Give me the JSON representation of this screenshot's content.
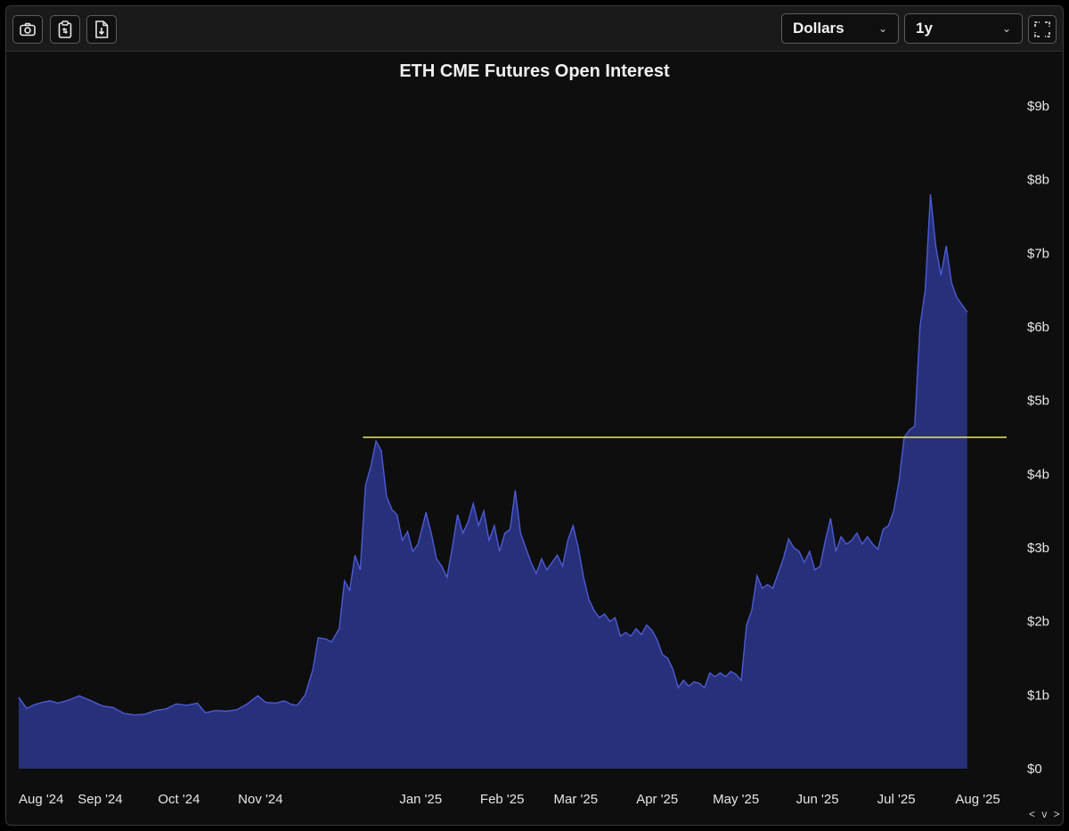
{
  "toolbar": {
    "buttons": [
      {
        "name": "camera-icon"
      },
      {
        "name": "clipboard-icon"
      },
      {
        "name": "download-file-icon"
      }
    ],
    "unit_select": {
      "value": "Dollars"
    },
    "range_select": {
      "value": "1y"
    },
    "fullscreen_icon": "fullscreen-icon"
  },
  "colors": {
    "background": "#0e0e0e",
    "area_fill": "#28307a",
    "area_stroke": "#4b5bd6",
    "reference_line": "#e8e85a"
  },
  "nav_hint": "< v >",
  "chart_data": {
    "type": "area",
    "title": "ETH CME Futures Open Interest",
    "xlabel": "",
    "ylabel": "",
    "ylim": [
      0,
      9
    ],
    "y_unit": "billions USD",
    "y_ticks": [
      "$0",
      "$1b",
      "$2b",
      "$3b",
      "$4b",
      "$5b",
      "$6b",
      "$7b",
      "$8b",
      "$9b"
    ],
    "y_tick_values": [
      0,
      1,
      2,
      3,
      4,
      5,
      6,
      7,
      8,
      9
    ],
    "x_ticks": [
      {
        "label": "Aug '24",
        "date": "2024-08-01"
      },
      {
        "label": "Sep '24",
        "date": "2024-09-01"
      },
      {
        "label": "Oct '24",
        "date": "2024-10-01"
      },
      {
        "label": "Nov '24",
        "date": "2024-11-01"
      },
      {
        "label": "Jan '25",
        "date": "2025-01-01"
      },
      {
        "label": "Feb '25",
        "date": "2025-02-01"
      },
      {
        "label": "Mar '25",
        "date": "2025-03-01"
      },
      {
        "label": "Apr '25",
        "date": "2025-04-01"
      },
      {
        "label": "May '25",
        "date": "2025-05-01"
      },
      {
        "label": "Jun '25",
        "date": "2025-06-01"
      },
      {
        "label": "Jul '25",
        "date": "2025-07-01"
      },
      {
        "label": "Aug '25",
        "date": "2025-08-01"
      }
    ],
    "x_range": [
      "2024-08-01",
      "2025-08-12"
    ],
    "reference_line": {
      "y": 4.5,
      "x_start": "2024-12-10",
      "x_end": "2025-08-12"
    },
    "series": [
      {
        "values": [
          [
            "2024-08-01",
            0.97
          ],
          [
            "2024-08-04",
            0.82
          ],
          [
            "2024-08-07",
            0.87
          ],
          [
            "2024-08-10",
            0.9
          ],
          [
            "2024-08-13",
            0.92
          ],
          [
            "2024-08-16",
            0.89
          ],
          [
            "2024-08-20",
            0.93
          ],
          [
            "2024-08-24",
            0.99
          ],
          [
            "2024-08-28",
            0.93
          ],
          [
            "2024-09-02",
            0.85
          ],
          [
            "2024-09-06",
            0.83
          ],
          [
            "2024-09-10",
            0.75
          ],
          [
            "2024-09-14",
            0.73
          ],
          [
            "2024-09-18",
            0.74
          ],
          [
            "2024-09-22",
            0.79
          ],
          [
            "2024-09-26",
            0.81
          ],
          [
            "2024-09-30",
            0.88
          ],
          [
            "2024-10-04",
            0.86
          ],
          [
            "2024-10-08",
            0.89
          ],
          [
            "2024-10-11",
            0.76
          ],
          [
            "2024-10-15",
            0.79
          ],
          [
            "2024-10-19",
            0.78
          ],
          [
            "2024-10-23",
            0.8
          ],
          [
            "2024-10-27",
            0.88
          ],
          [
            "2024-10-31",
            0.99
          ],
          [
            "2024-11-03",
            0.9
          ],
          [
            "2024-11-07",
            0.89
          ],
          [
            "2024-11-10",
            0.92
          ],
          [
            "2024-11-13",
            0.87
          ],
          [
            "2024-11-15",
            0.86
          ],
          [
            "2024-11-18",
            1.0
          ],
          [
            "2024-11-21",
            1.35
          ],
          [
            "2024-11-23",
            1.78
          ],
          [
            "2024-11-26",
            1.76
          ],
          [
            "2024-11-28",
            1.72
          ],
          [
            "2024-12-01",
            1.9
          ],
          [
            "2024-12-03",
            2.55
          ],
          [
            "2024-12-05",
            2.42
          ],
          [
            "2024-12-07",
            2.9
          ],
          [
            "2024-12-09",
            2.7
          ],
          [
            "2024-12-11",
            3.85
          ],
          [
            "2024-12-13",
            4.1
          ],
          [
            "2024-12-15",
            4.45
          ],
          [
            "2024-12-17",
            4.32
          ],
          [
            "2024-12-19",
            3.7
          ],
          [
            "2024-12-21",
            3.52
          ],
          [
            "2024-12-23",
            3.45
          ],
          [
            "2024-12-25",
            3.1
          ],
          [
            "2024-12-27",
            3.22
          ],
          [
            "2024-12-29",
            2.95
          ],
          [
            "2024-12-31",
            3.05
          ],
          [
            "2025-01-03",
            3.48
          ],
          [
            "2025-01-05",
            3.2
          ],
          [
            "2025-01-07",
            2.85
          ],
          [
            "2025-01-09",
            2.75
          ],
          [
            "2025-01-11",
            2.6
          ],
          [
            "2025-01-13",
            3.0
          ],
          [
            "2025-01-15",
            3.45
          ],
          [
            "2025-01-17",
            3.2
          ],
          [
            "2025-01-19",
            3.35
          ],
          [
            "2025-01-21",
            3.6
          ],
          [
            "2025-01-23",
            3.3
          ],
          [
            "2025-01-25",
            3.5
          ],
          [
            "2025-01-27",
            3.1
          ],
          [
            "2025-01-29",
            3.3
          ],
          [
            "2025-01-31",
            2.95
          ],
          [
            "2025-02-02",
            3.2
          ],
          [
            "2025-02-04",
            3.25
          ],
          [
            "2025-02-06",
            3.78
          ],
          [
            "2025-02-08",
            3.2
          ],
          [
            "2025-02-10",
            3.0
          ],
          [
            "2025-02-12",
            2.8
          ],
          [
            "2025-02-14",
            2.65
          ],
          [
            "2025-02-16",
            2.85
          ],
          [
            "2025-02-18",
            2.7
          ],
          [
            "2025-02-20",
            2.8
          ],
          [
            "2025-02-22",
            2.9
          ],
          [
            "2025-02-24",
            2.75
          ],
          [
            "2025-02-26",
            3.1
          ],
          [
            "2025-02-28",
            3.3
          ],
          [
            "2025-03-02",
            3.0
          ],
          [
            "2025-03-04",
            2.6
          ],
          [
            "2025-03-06",
            2.3
          ],
          [
            "2025-03-08",
            2.15
          ],
          [
            "2025-03-10",
            2.05
          ],
          [
            "2025-03-12",
            2.1
          ],
          [
            "2025-03-14",
            2.0
          ],
          [
            "2025-03-16",
            2.05
          ],
          [
            "2025-03-18",
            1.8
          ],
          [
            "2025-03-20",
            1.85
          ],
          [
            "2025-03-22",
            1.8
          ],
          [
            "2025-03-24",
            1.9
          ],
          [
            "2025-03-26",
            1.82
          ],
          [
            "2025-03-28",
            1.95
          ],
          [
            "2025-03-30",
            1.88
          ],
          [
            "2025-04-01",
            1.75
          ],
          [
            "2025-04-03",
            1.55
          ],
          [
            "2025-04-05",
            1.5
          ],
          [
            "2025-04-07",
            1.35
          ],
          [
            "2025-04-09",
            1.1
          ],
          [
            "2025-04-11",
            1.2
          ],
          [
            "2025-04-13",
            1.12
          ],
          [
            "2025-04-15",
            1.18
          ],
          [
            "2025-04-17",
            1.16
          ],
          [
            "2025-04-19",
            1.1
          ],
          [
            "2025-04-21",
            1.3
          ],
          [
            "2025-04-23",
            1.25
          ],
          [
            "2025-04-25",
            1.3
          ],
          [
            "2025-04-27",
            1.25
          ],
          [
            "2025-04-29",
            1.32
          ],
          [
            "2025-05-01",
            1.28
          ],
          [
            "2025-05-03",
            1.2
          ],
          [
            "2025-05-05",
            1.95
          ],
          [
            "2025-05-07",
            2.15
          ],
          [
            "2025-05-09",
            2.62
          ],
          [
            "2025-05-11",
            2.45
          ],
          [
            "2025-05-13",
            2.5
          ],
          [
            "2025-05-15",
            2.45
          ],
          [
            "2025-05-17",
            2.65
          ],
          [
            "2025-05-19",
            2.85
          ],
          [
            "2025-05-21",
            3.12
          ],
          [
            "2025-05-23",
            3.0
          ],
          [
            "2025-05-25",
            2.95
          ],
          [
            "2025-05-27",
            2.8
          ],
          [
            "2025-05-29",
            2.95
          ],
          [
            "2025-05-31",
            2.7
          ],
          [
            "2025-06-02",
            2.75
          ],
          [
            "2025-06-04",
            3.1
          ],
          [
            "2025-06-06",
            3.4
          ],
          [
            "2025-06-08",
            2.95
          ],
          [
            "2025-06-10",
            3.15
          ],
          [
            "2025-06-12",
            3.05
          ],
          [
            "2025-06-14",
            3.1
          ],
          [
            "2025-06-16",
            3.2
          ],
          [
            "2025-06-18",
            3.05
          ],
          [
            "2025-06-20",
            3.15
          ],
          [
            "2025-06-22",
            3.05
          ],
          [
            "2025-06-24",
            2.98
          ],
          [
            "2025-06-26",
            3.25
          ],
          [
            "2025-06-28",
            3.3
          ],
          [
            "2025-06-30",
            3.5
          ],
          [
            "2025-07-02",
            3.9
          ],
          [
            "2025-07-04",
            4.5
          ],
          [
            "2025-07-06",
            4.6
          ],
          [
            "2025-07-08",
            4.65
          ],
          [
            "2025-07-10",
            6.0
          ],
          [
            "2025-07-12",
            6.5
          ],
          [
            "2025-07-14",
            7.8
          ],
          [
            "2025-07-16",
            7.1
          ],
          [
            "2025-07-18",
            6.7
          ],
          [
            "2025-07-20",
            7.1
          ],
          [
            "2025-07-22",
            6.6
          ],
          [
            "2025-07-24",
            6.4
          ],
          [
            "2025-07-26",
            6.3
          ],
          [
            "2025-07-28",
            6.2
          ]
        ]
      }
    ]
  }
}
